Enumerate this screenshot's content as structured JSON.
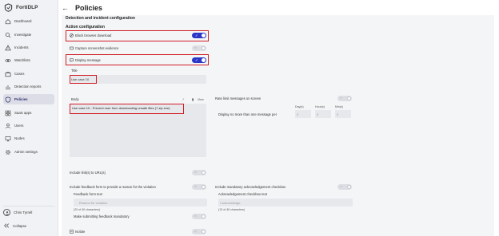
{
  "app": {
    "name": "FortiDLP"
  },
  "sidebar": {
    "items": [
      {
        "label": "Dashboard",
        "icon": "dashboard-icon"
      },
      {
        "label": "Investigate",
        "icon": "search-icon"
      },
      {
        "label": "Incidents",
        "icon": "warning-icon"
      },
      {
        "label": "Watchlists",
        "icon": "eye-icon"
      },
      {
        "label": "Cases",
        "icon": "briefcase-icon"
      },
      {
        "label": "Detection reports",
        "icon": "chart-icon"
      },
      {
        "label": "Policies",
        "icon": "shield-icon",
        "active": true
      },
      {
        "label": "SaaS apps",
        "icon": "grid-icon"
      },
      {
        "label": "Users",
        "icon": "users-icon"
      },
      {
        "label": "Nodes",
        "icon": "monitor-icon"
      },
      {
        "label": "Admin settings",
        "icon": "gear-icon"
      }
    ],
    "user_name": "Chris Tyrrell",
    "collapse_label": "Collapse"
  },
  "header": {
    "title": "Policies"
  },
  "sections": {
    "detection": "Detection and incident configuration",
    "action": "Action configuration"
  },
  "actions": {
    "block_browser_download": "Block browser download",
    "capture_screenshot": "Capture screenshot evidence",
    "display_message": "Display message"
  },
  "message": {
    "title_label": "Title",
    "title_value": "Use case 10",
    "body_label": "Body",
    "body_value": "Use case 10 - Prevent user from downloading unsafe files (7-zip.exe)",
    "view_label": "View"
  },
  "rate_limit": {
    "label": "Rate limit messages on screen",
    "desc": "Display no more than one message per",
    "days_label": "Day(s)",
    "hours_label": "Hour(s)",
    "mins_label": "Min(s)",
    "days_value": "0",
    "hours_value": "0",
    "mins_value": "0"
  },
  "links": {
    "include_links": "Include link(s) to URL(s)"
  },
  "feedback": {
    "include_form": "Include feedback form to provide a reason for the violation",
    "form_text_label": "Feedback form text",
    "form_text_placeholder": "Reason for violation",
    "form_text_count": "(20 of 40 characters)",
    "mandatory_label": "Make submitting feedback mandatory"
  },
  "acknowledgement": {
    "include_label": "Include mandatory acknowledgement checkbox",
    "checkbox_text_label": "Acknowledgement checkbox text",
    "checkbox_text_placeholder": "I acknowledge",
    "checkbox_text_count": "(13 of 40 characters)"
  },
  "isolate": {
    "label": "Isolate"
  },
  "colors": {
    "accent": "#2b36c9",
    "highlight": "#d11d25",
    "sidebar_bg": "#f1f2f5"
  }
}
